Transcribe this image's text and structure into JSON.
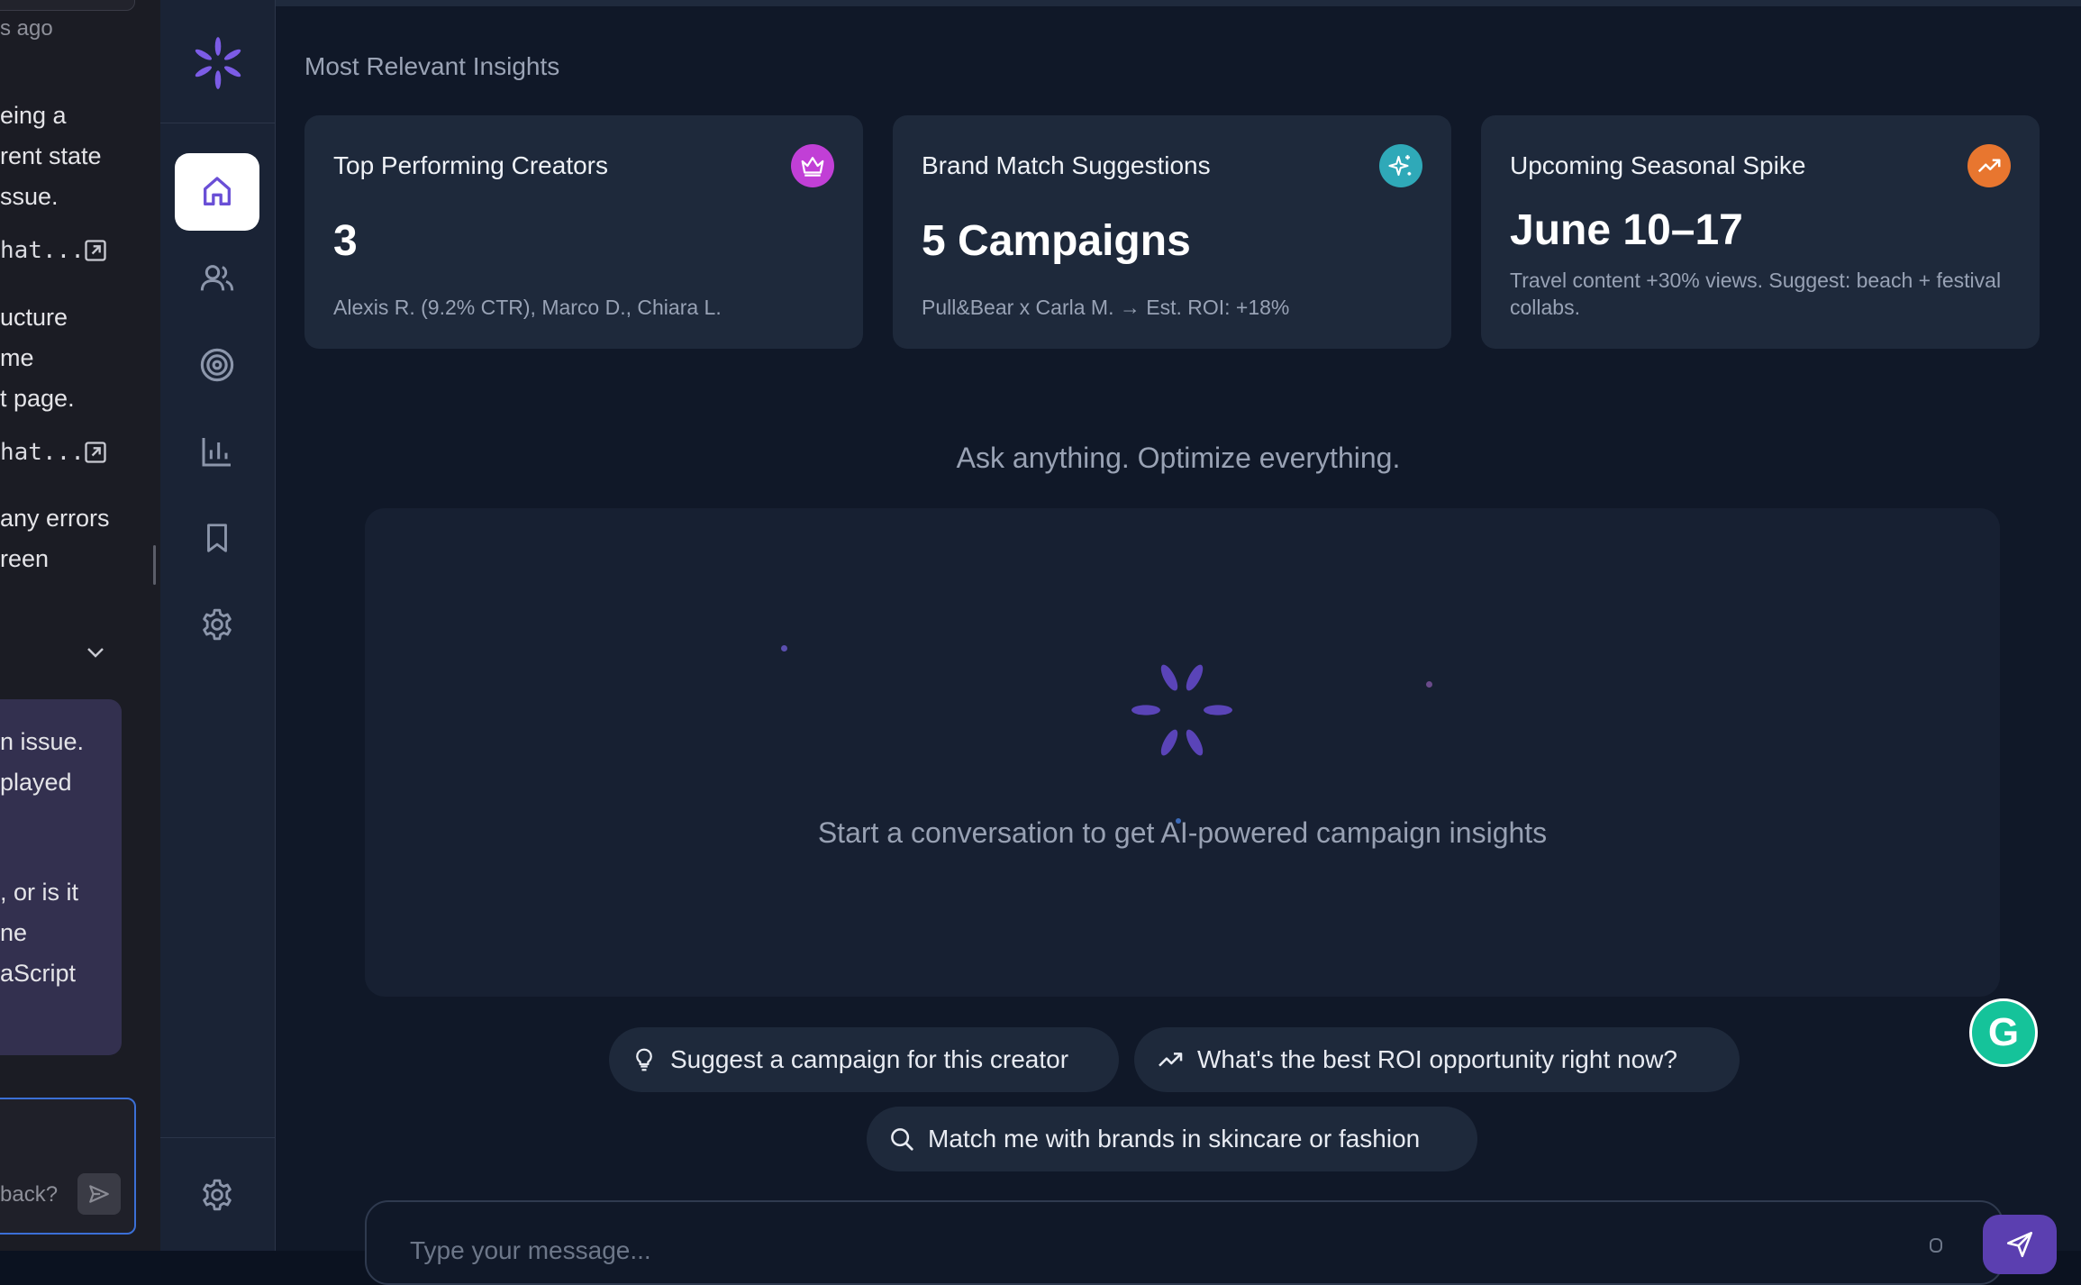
{
  "chat_panel": {
    "time_ago": "s ago",
    "lines_1": [
      "eing a",
      "rent state",
      "ssue."
    ],
    "code_1": "hat...",
    "lines_2": [
      "ucture",
      "me",
      "t page."
    ],
    "code_2": "hat...",
    "lines_3": [
      "any errors",
      "reen"
    ],
    "bubble_lines_1": [
      "n issue.",
      "played"
    ],
    "bubble_lines_2": [
      ", or is it",
      "ne",
      "aScript"
    ],
    "input_placeholder": "back?"
  },
  "rail": {
    "items": [
      {
        "icon": "home-icon",
        "active": true
      },
      {
        "icon": "users-icon",
        "active": false
      },
      {
        "icon": "target-icon",
        "active": false
      },
      {
        "icon": "bar-chart-icon",
        "active": false
      },
      {
        "icon": "bookmark-icon",
        "active": false
      },
      {
        "icon": "settings-icon",
        "active": false
      }
    ],
    "bottom_icon": "settings-icon"
  },
  "insights": {
    "section_title": "Most Relevant Insights",
    "cards": [
      {
        "title": "Top Performing Creators",
        "value": "3",
        "detail": "Alexis R. (9.2% CTR), Marco D., Chiara L.",
        "icon": "crown-icon",
        "badge_color": "#c13fd6"
      },
      {
        "title": "Brand Match Suggestions",
        "value": "5 Campaigns",
        "detail": "Pull&Bear x Carla M. → Est. ROI: +18%",
        "icon": "sparkles-icon",
        "badge_color": "#2fa9b8"
      },
      {
        "title": "Upcoming Seasonal Spike",
        "value": "June 10–17",
        "detail": "Travel content +30% views. Suggest: beach + festival collabs.",
        "icon": "trending-up-icon",
        "badge_color": "#e8762f"
      }
    ]
  },
  "assistant": {
    "tagline": "Ask anything. Optimize everything.",
    "empty_state": "Start a conversation to get AI-powered campaign insights",
    "suggestions": [
      {
        "label": "Suggest a campaign for this creator",
        "icon": "lightbulb-icon"
      },
      {
        "label": "What's the best ROI opportunity right now?",
        "icon": "trending-up-icon"
      },
      {
        "label": "Match me with brands in skincare or fashion",
        "icon": "search-icon"
      }
    ],
    "input_placeholder": "Type your message..."
  },
  "colors": {
    "accent": "#6a4fd6",
    "background": "#101828",
    "card": "#1e293b"
  }
}
